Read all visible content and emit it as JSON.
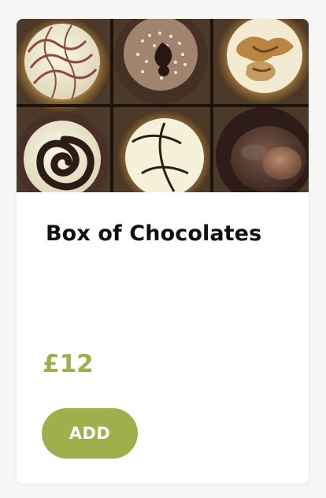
{
  "product": {
    "image_alt": "Assorted chocolates in a box",
    "title": "Box of Chocolates",
    "price": "£12",
    "add_label": "ADD"
  },
  "colors": {
    "accent": "#a0ae4b",
    "title_text": "#111111",
    "card_background": "#ffffff",
    "page_background": "#f6f6f5"
  }
}
